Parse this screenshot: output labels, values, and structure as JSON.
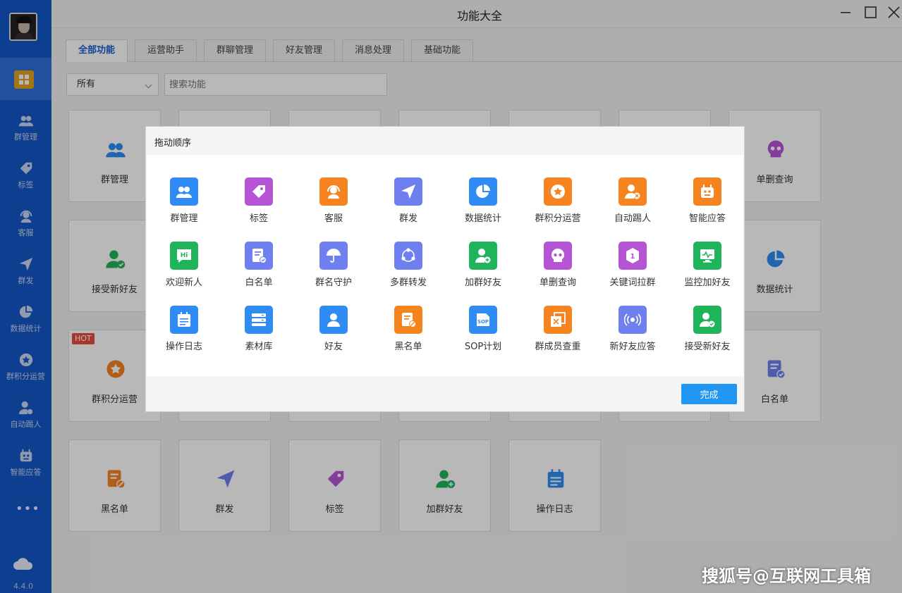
{
  "window": {
    "title": "功能大全"
  },
  "sidebar": {
    "items": [
      {
        "label": "群管理",
        "icon": "group-icon"
      },
      {
        "label": "标签",
        "icon": "tag-icon"
      },
      {
        "label": "客服",
        "icon": "headset-icon"
      },
      {
        "label": "群发",
        "icon": "send-icon"
      },
      {
        "label": "数据统计",
        "icon": "pie-chart-icon"
      },
      {
        "label": "群积分运营",
        "icon": "star-badge-icon"
      },
      {
        "label": "自动踢人",
        "icon": "user-remove-icon"
      },
      {
        "label": "智能应答",
        "icon": "robot-icon"
      }
    ],
    "more": "•••",
    "version": "4.4.0"
  },
  "tabs": [
    "全部功能",
    "运营助手",
    "群聊管理",
    "好友管理",
    "消息处理",
    "基础功能"
  ],
  "filter": {
    "selected": "所有",
    "search_placeholder": "搜索功能"
  },
  "grid": {
    "hot_badge": "HOT",
    "cards": [
      {
        "label": "群管理"
      },
      {
        "label": "单删查询"
      },
      {
        "label": "接受新好友"
      },
      {
        "label": "数据统计"
      },
      {
        "label": "群积分运营"
      },
      {
        "label": "白名单"
      },
      {
        "label": "黑名单"
      },
      {
        "label": "群发"
      },
      {
        "label": "标签"
      },
      {
        "label": "加群好友"
      },
      {
        "label": "操作日志"
      }
    ]
  },
  "dialog": {
    "title": "拖动顺序",
    "done_label": "完成",
    "items": [
      {
        "label": "群管理",
        "color": "#2f8cf5",
        "icon": "group-icon"
      },
      {
        "label": "标签",
        "color": "#b654d6",
        "icon": "tag-icon"
      },
      {
        "label": "客服",
        "color": "#f5841f",
        "icon": "headset-icon"
      },
      {
        "label": "群发",
        "color": "#6f7ff0",
        "icon": "send-icon"
      },
      {
        "label": "数据统计",
        "color": "#2f8cf5",
        "icon": "pie-chart-icon"
      },
      {
        "label": "群积分运营",
        "color": "#f5841f",
        "icon": "star-badge-icon"
      },
      {
        "label": "自动踢人",
        "color": "#f5841f",
        "icon": "user-remove-icon"
      },
      {
        "label": "智能应答",
        "color": "#f5841f",
        "icon": "robot-icon"
      },
      {
        "label": "欢迎新人",
        "color": "#1fb35a",
        "icon": "hi-bubble-icon"
      },
      {
        "label": "白名单",
        "color": "#6f7ff0",
        "icon": "whitelist-icon"
      },
      {
        "label": "群名守护",
        "color": "#6f7ff0",
        "icon": "umbrella-icon"
      },
      {
        "label": "多群转发",
        "color": "#6f7ff0",
        "icon": "share-circle-icon"
      },
      {
        "label": "加群好友",
        "color": "#1fb35a",
        "icon": "user-add-icon"
      },
      {
        "label": "单删查询",
        "color": "#b654d6",
        "icon": "skull-icon"
      },
      {
        "label": "关键词拉群",
        "color": "#b654d6",
        "icon": "keyword-icon"
      },
      {
        "label": "监控加好友",
        "color": "#1fb35a",
        "icon": "monitor-icon"
      },
      {
        "label": "操作日志",
        "color": "#2f8cf5",
        "icon": "calendar-log-icon"
      },
      {
        "label": "素材库",
        "color": "#2f8cf5",
        "icon": "database-icon"
      },
      {
        "label": "好友",
        "color": "#2f8cf5",
        "icon": "user-icon"
      },
      {
        "label": "黑名单",
        "color": "#f5841f",
        "icon": "blacklist-icon"
      },
      {
        "label": "SOP计划",
        "color": "#2f8cf5",
        "icon": "sop-icon"
      },
      {
        "label": "群成员查重",
        "color": "#f5841f",
        "icon": "duplicate-icon"
      },
      {
        "label": "新好友应答",
        "color": "#6f7ff0",
        "icon": "broadcast-icon"
      },
      {
        "label": "接受新好友",
        "color": "#1fb35a",
        "icon": "user-check-icon"
      }
    ]
  },
  "watermark": "搜狐号@互联网工具箱"
}
